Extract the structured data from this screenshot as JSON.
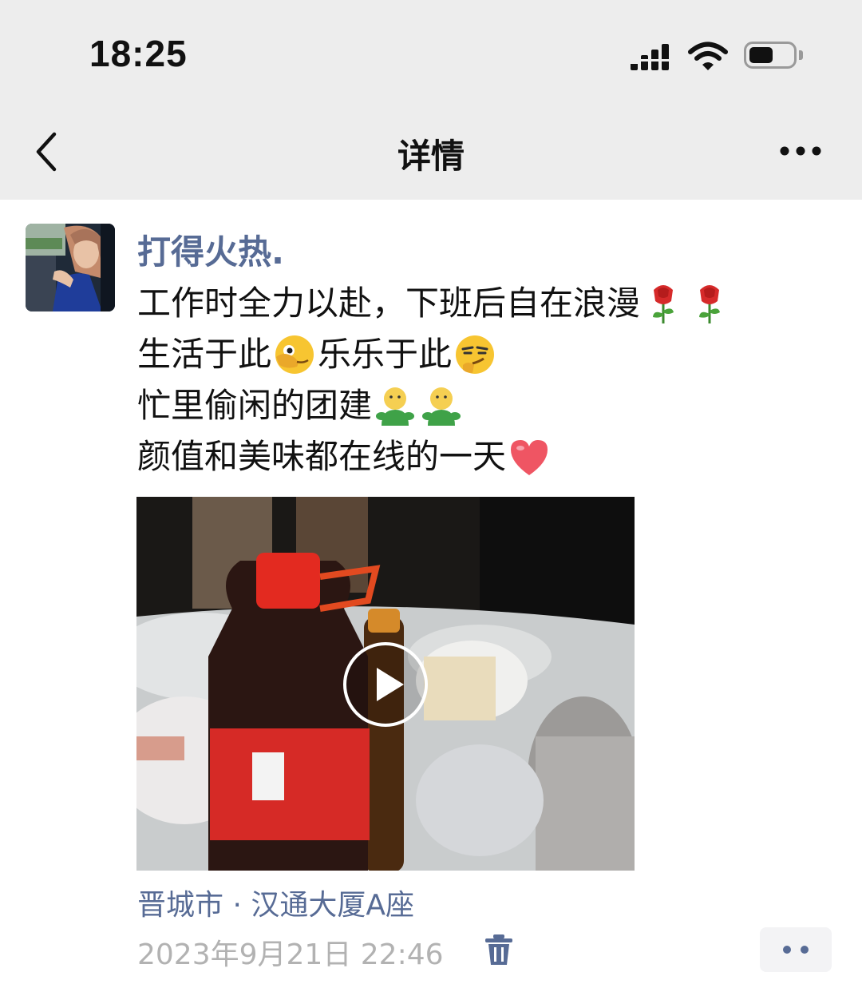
{
  "status_bar": {
    "time": "18:25",
    "battery_level": 0.55,
    "icons": [
      "signal-icon",
      "wifi-icon",
      "battery-icon"
    ]
  },
  "nav": {
    "title": "详情",
    "back_icon": "chevron-left-icon",
    "more_icon": "more-icon"
  },
  "post": {
    "author": "打得火热.",
    "lines": [
      {
        "text": "工作时全力以赴，下班后自在浪漫",
        "emojis": [
          "rose-icon",
          "rose-icon"
        ]
      },
      {
        "text_a": "生活于此",
        "emoji_a": "peek-face-icon",
        "text_b": "乐乐于此",
        "emoji_b": "smirk-face-icon"
      },
      {
        "text": "忙里偷闲的团建",
        "emojis": [
          "hug-emoji-icon",
          "hug-emoji-icon"
        ]
      },
      {
        "text": "颜值和美味都在线的一天",
        "emojis": [
          "heart-icon"
        ]
      }
    ],
    "video_icon": "play-icon",
    "location": "晋城市 · 汉通大厦A座",
    "timestamp": "2023年9月21日 22:46",
    "delete_icon": "trash-icon",
    "action_icon": "more-dots-icon"
  },
  "colors": {
    "link": "#576b95",
    "meta": "#b2b2b2",
    "bar_bg": "#ededed"
  }
}
